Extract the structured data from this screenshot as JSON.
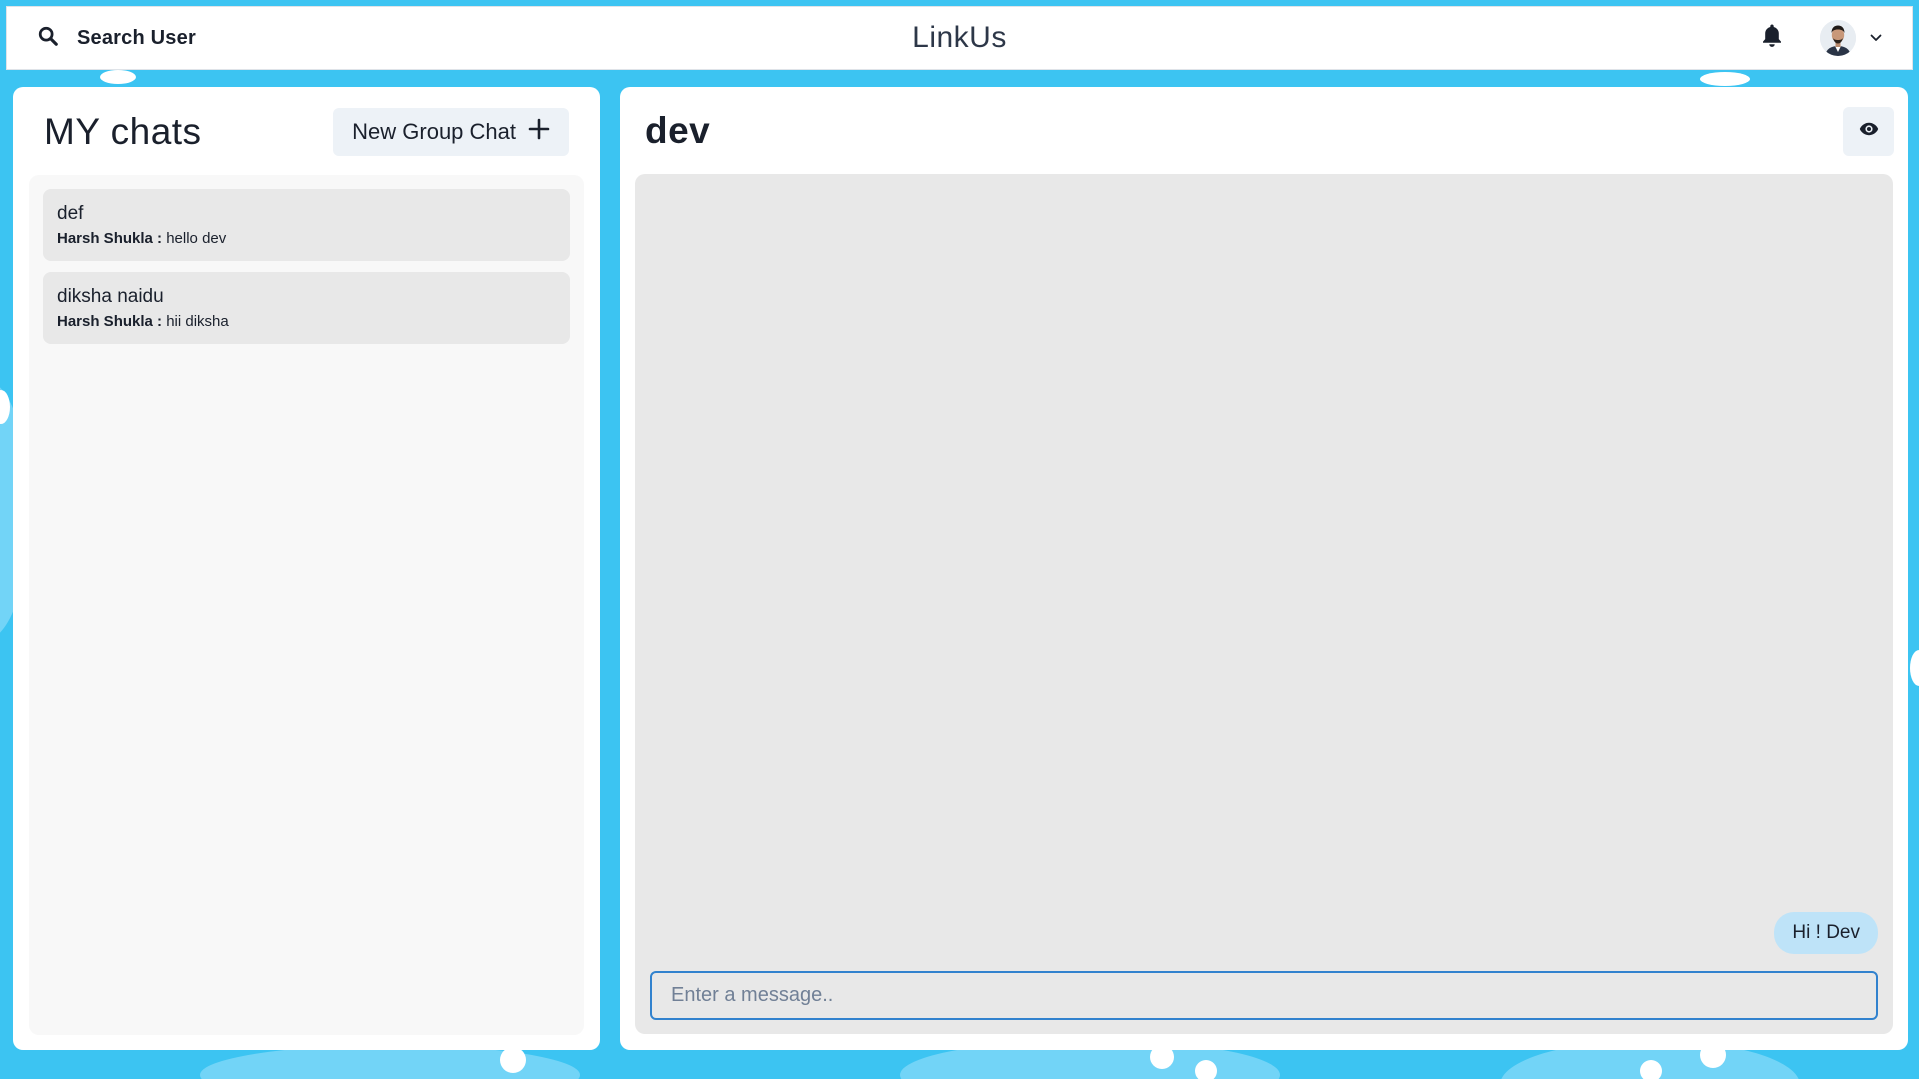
{
  "app": {
    "title": "LinkUs"
  },
  "topbar": {
    "search_label": "Search User"
  },
  "chats_panel": {
    "title": "MY chats",
    "new_group_label": "New Group Chat",
    "chats": [
      {
        "name": "def",
        "sender": "Harsh Shukla :",
        "message": "hello dev"
      },
      {
        "name": "diksha naidu",
        "sender": "Harsh Shukla :",
        "message": "hii diksha"
      }
    ]
  },
  "conversation": {
    "title": "dev",
    "messages": [
      {
        "text": "Hi ! Dev"
      }
    ],
    "input_placeholder": "Enter a message.."
  },
  "icons": {
    "search": "search-icon",
    "bell": "bell-icon",
    "avatar": "avatar",
    "chevron": "chevron-down-icon",
    "plus": "plus-icon",
    "eye": "eye-icon"
  },
  "colors": {
    "background": "#3cc4f2",
    "bubble": "#bee3f8",
    "input_border": "#3182ce"
  }
}
